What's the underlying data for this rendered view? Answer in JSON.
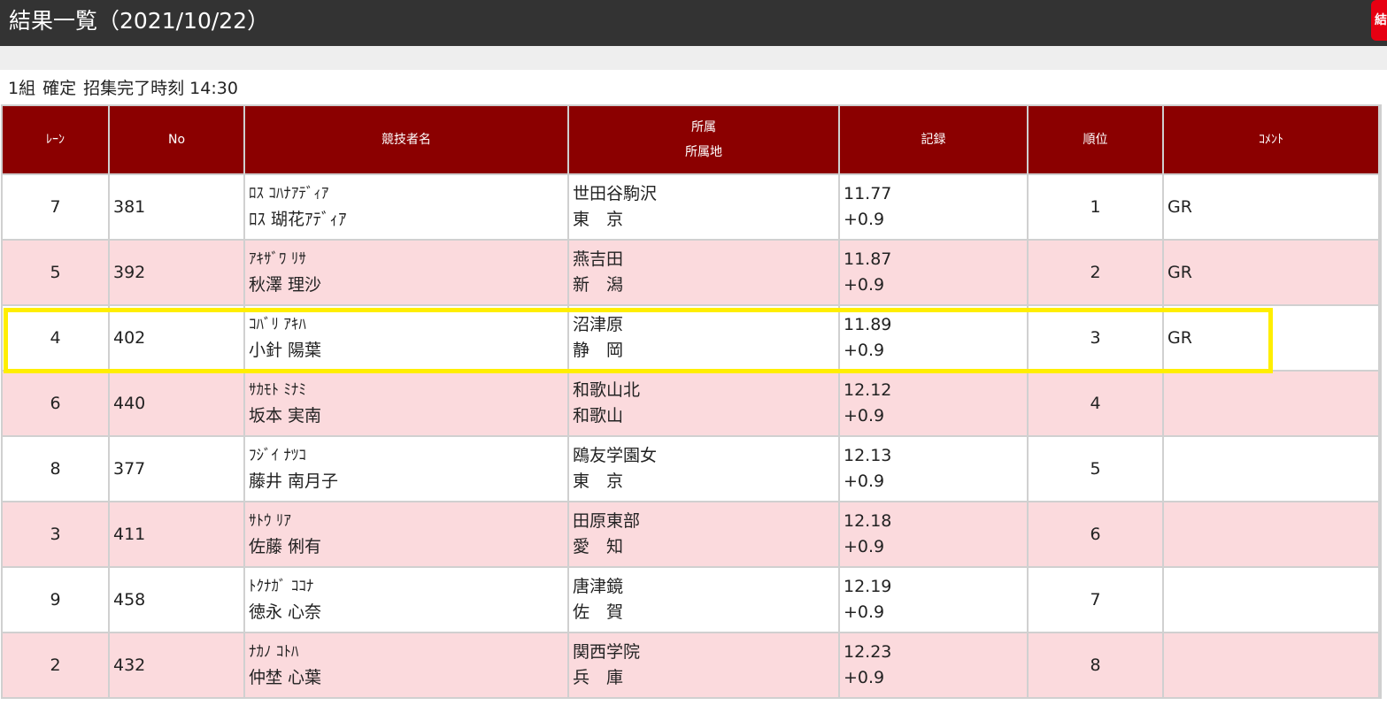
{
  "page": {
    "title": "結果一覧（2021/10/22）",
    "corner_badge": "結"
  },
  "heat": {
    "group": "1組",
    "status": "確定",
    "call_time": "招集完了時刻 14:30"
  },
  "columns": {
    "lane": "ﾚｰﾝ",
    "no": "No",
    "name": "競技者名",
    "team": "所属",
    "region": "所属地",
    "record": "記録",
    "rank": "順位",
    "comment": "ｺﾒﾝﾄ"
  },
  "rows": [
    {
      "lane": "7",
      "no": "381",
      "kana": "ﾛｽ ｺﾊﾅｱﾃﾞｨｱ",
      "name": "ﾛｽ 瑚花ｱﾃﾞｨｱ",
      "team": "世田谷駒沢",
      "region": "東　京",
      "time": "11.77",
      "wind": "+0.9",
      "rank": "1",
      "comment": "GR"
    },
    {
      "lane": "5",
      "no": "392",
      "kana": "ｱｷｻﾞﾜ ﾘｻ",
      "name": "秋澤 理沙",
      "team": "燕吉田",
      "region": "新　潟",
      "time": "11.87",
      "wind": "+0.9",
      "rank": "2",
      "comment": "GR"
    },
    {
      "lane": "4",
      "no": "402",
      "kana": "ｺﾊﾞﾘ ｱｷﾊ",
      "name": "小針 陽葉",
      "team": "沼津原",
      "region": "静　岡",
      "time": "11.89",
      "wind": "+0.9",
      "rank": "3",
      "comment": "GR"
    },
    {
      "lane": "6",
      "no": "440",
      "kana": "ｻｶﾓﾄ ﾐﾅﾐ",
      "name": "坂本 実南",
      "team": "和歌山北",
      "region": "和歌山",
      "time": "12.12",
      "wind": "+0.9",
      "rank": "4",
      "comment": ""
    },
    {
      "lane": "8",
      "no": "377",
      "kana": "ﾌｼﾞｲ ﾅﾂｺ",
      "name": "藤井 南月子",
      "team": "鴎友学園女",
      "region": "東　京",
      "time": "12.13",
      "wind": "+0.9",
      "rank": "5",
      "comment": ""
    },
    {
      "lane": "3",
      "no": "411",
      "kana": "ｻﾄｳ ﾘｱ",
      "name": "佐藤 俐有",
      "team": "田原東部",
      "region": "愛　知",
      "time": "12.18",
      "wind": "+0.9",
      "rank": "6",
      "comment": ""
    },
    {
      "lane": "9",
      "no": "458",
      "kana": "ﾄｸﾅｶﾞ ｺｺﾅ",
      "name": "徳永 心奈",
      "team": "唐津鏡",
      "region": "佐　賀",
      "time": "12.19",
      "wind": "+0.9",
      "rank": "7",
      "comment": ""
    },
    {
      "lane": "2",
      "no": "432",
      "kana": "ﾅｶﾉ ｺﾄﾊ",
      "name": "仲埜 心葉",
      "team": "関西学院",
      "region": "兵　庫",
      "time": "12.23",
      "wind": "+0.9",
      "rank": "8",
      "comment": ""
    }
  ],
  "colors": {
    "title_bar": "#333333",
    "header_bg": "#8b0000",
    "row_alt_bg": "#fbdadd",
    "highlight_border": "#ffee00"
  }
}
